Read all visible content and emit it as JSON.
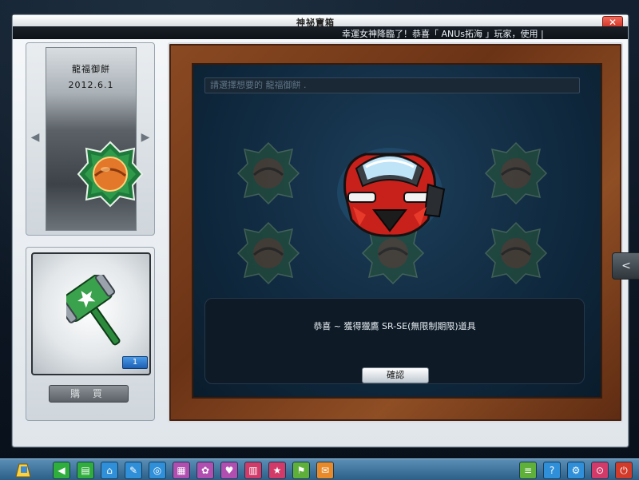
{
  "window": {
    "title": "神祕寶箱",
    "close_label": "✕"
  },
  "ticker": {
    "text": "幸運女神降臨了！恭喜「 ANUs拓海 」玩家，使用 |"
  },
  "item_viewer": {
    "name": "龍福御餅",
    "date": "2012.6.1",
    "prev_label": "◀",
    "next_label": "▶"
  },
  "item_panel": {
    "quantity": "1",
    "buy_label": "購 買"
  },
  "stage": {
    "select_placeholder": "請選擇想要的 龍福御餅  .",
    "message": "恭喜 ~ 獲得獵鷹 SR-SE(無限制期限)道具",
    "confirm_label": "確認"
  },
  "side_tab": {
    "label": "<"
  },
  "taskbar": {
    "items": [
      {
        "icon": "back-arrow-icon",
        "glyph": "◀",
        "color": "#2fae3e"
      },
      {
        "icon": "shop-icon",
        "glyph": "▤",
        "color": "#2fae3e"
      },
      {
        "icon": "home-icon",
        "glyph": "⌂",
        "color": "#2f8fd8"
      },
      {
        "icon": "wrench-icon",
        "glyph": "✎",
        "color": "#2f8fd8"
      },
      {
        "icon": "account-icon",
        "glyph": "◎",
        "color": "#2f8fd8"
      },
      {
        "icon": "gift-icon",
        "glyph": "▦",
        "color": "#b14fb1"
      },
      {
        "icon": "flower-icon",
        "glyph": "✿",
        "color": "#b14fb1"
      },
      {
        "icon": "heart-icon",
        "glyph": "♥",
        "color": "#b14fb1"
      },
      {
        "icon": "book-icon",
        "glyph": "▥",
        "color": "#d23a6a"
      },
      {
        "icon": "stars-icon",
        "glyph": "★",
        "color": "#d23a6a"
      },
      {
        "icon": "flag-icon",
        "glyph": "⚑",
        "color": "#5fb03a"
      },
      {
        "icon": "mail-icon",
        "glyph": "✉",
        "color": "#e88a2a"
      }
    ],
    "right_items": [
      {
        "icon": "list-icon",
        "glyph": "≡",
        "color": "#5fb03a"
      },
      {
        "icon": "help-icon",
        "glyph": "?",
        "color": "#2f8fd8"
      },
      {
        "icon": "settings-icon",
        "glyph": "⚙",
        "color": "#2f8fd8"
      },
      {
        "icon": "search-icon",
        "glyph": "⊙",
        "color": "#d23a6a"
      },
      {
        "icon": "power-icon",
        "glyph": "⏻",
        "color": "#d23a2a"
      }
    ]
  }
}
